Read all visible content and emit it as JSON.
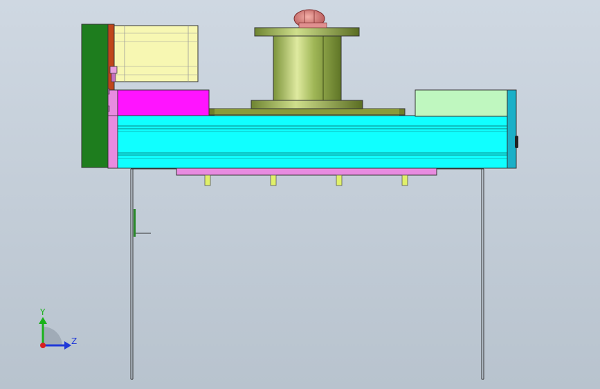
{
  "triad": {
    "y_label": "Y",
    "z_label": "Z",
    "y_color": "#19b219",
    "z_color": "#1f38d8",
    "x_color": "#d81f1f"
  },
  "colors": {
    "background_top": "#cfd8e2",
    "background_bottom": "#b8c3ce",
    "green_plate": "#1e7d1e",
    "orange_bracket": "#c0461a",
    "motor_body": "#f7f7b2",
    "magenta_block": "#ff14ff",
    "pink_bar": "#e88be0",
    "cyan_rail": "#10ffff",
    "light_green_block": "#bff7bf",
    "teal_end_cap": "#1ab0c8",
    "olive_base": "#6f7f2a",
    "spool": "#8fa84e",
    "top_cap": "#d97a7a",
    "yellow_studs": "#e0f06a",
    "frame_line": "#333333"
  }
}
